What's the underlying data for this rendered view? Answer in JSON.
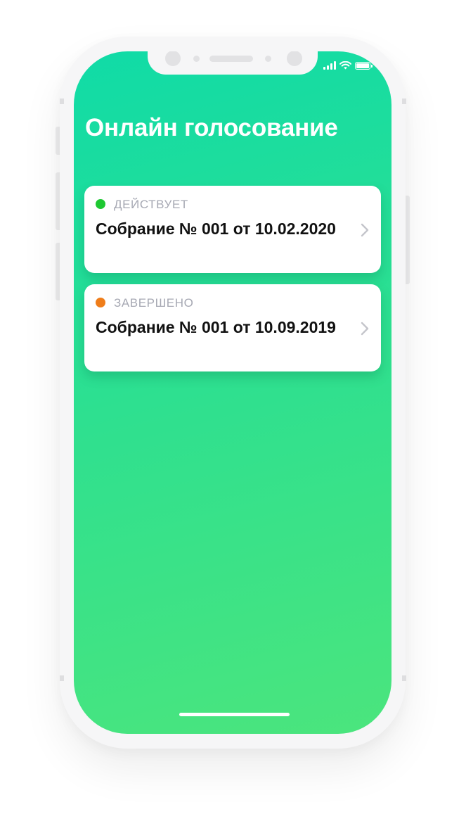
{
  "screen": {
    "title": "Онлайн голосование"
  },
  "status_bar": {
    "signal_icon": "cellular-signal-icon",
    "wifi_icon": "wifi-icon",
    "battery_icon": "battery-icon",
    "battery_level": 1.0
  },
  "meetings": [
    {
      "status": "ДЕЙСТВУЕТ",
      "status_color": "#1ec832",
      "title": "Собрание № 001 от 10.02.2020",
      "chevron_icon": "chevron-right-icon"
    },
    {
      "status": "ЗАВЕРШЕНО",
      "status_color": "#ef7d1a",
      "title": "Собрание № 001 от 10.09.2019",
      "chevron_icon": "chevron-right-icon"
    }
  ],
  "colors": {
    "gradient_top": "#10dba7",
    "gradient_bottom": "#4be57d",
    "card_background": "#ffffff",
    "status_text": "#a6a8b3"
  }
}
